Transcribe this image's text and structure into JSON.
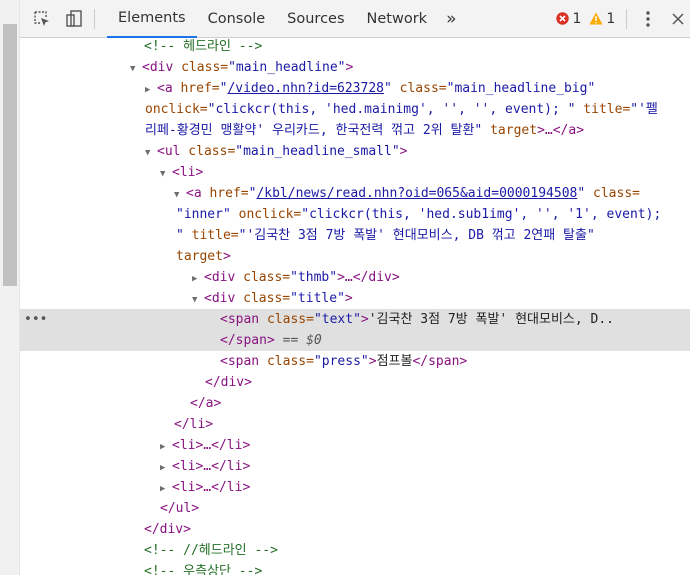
{
  "toolbar": {
    "tabs": [
      "Elements",
      "Console",
      "Sources",
      "Network"
    ],
    "more": "»",
    "error_count": "1",
    "warning_count": "1"
  },
  "tree": {
    "l01": "<!-- 헤드라인 -->",
    "l02_tag": "<div",
    "l02_attr": " class=",
    "l02_val": "\"main_headline\"",
    "l02_end": ">",
    "l03_tag": "<a",
    "l03_attr1": " href=",
    "l03_q1": "\"",
    "l03_link": "/video.nhn?id=623728",
    "l03_q2": "\"",
    "l03_attr2": " class=",
    "l03_val2": "\"main_headline_big\"",
    "l04_attr": "onclick=",
    "l04_val": "\"clickcr(this, 'hed.mainimg', '', '', event); \"",
    "l04_attr2": " title=",
    "l04_val2": "\"'펠",
    "l05_val": "리페-황경민 맹활약' 우리카드, 한국전력 꺾고 2위 탈환\"",
    "l05_attr": " target",
    "l05_end": ">…</a>",
    "l06_tag": "<ul",
    "l06_attr": " class=",
    "l06_val": "\"main_headline_small\"",
    "l06_end": ">",
    "l07": "<li>",
    "l08_tag": "<a",
    "l08_attr": " href=",
    "l08_q1": "\"",
    "l08_link": "/kbl/news/read.nhn?oid=065&aid=0000194508",
    "l08_q2": "\"",
    "l08_attr2": " class=",
    "l09_val": "\"inner\"",
    "l09_attr": " onclick=",
    "l09_val2": "\"clickcr(this, 'hed.sub1img', '', '1', event);",
    "l10_val": "\"",
    "l10_attr": " title=",
    "l10_val2": "\"'김국찬 3점 7방 폭발' 현대모비스, DB 꺾고 2연패 탈출\"",
    "l11_attr": "target",
    "l11_end": ">",
    "l12_tag": "<div",
    "l12_attr": " class=",
    "l12_val": "\"thmb\"",
    "l12_end": ">…</div>",
    "l13_tag": "<div",
    "l13_attr": " class=",
    "l13_val": "\"title\"",
    "l13_end": ">",
    "l14_tag": "<span",
    "l14_attr": " class=",
    "l14_val": "\"text\"",
    "l14_gt": ">",
    "l14_text": "'김국찬 3점 7방 폭발' 현대모비스, D..",
    "l15_tag": "</span>",
    "l15_eq": " == $0",
    "l16_tag": "<span",
    "l16_attr": " class=",
    "l16_val": "\"press\"",
    "l16_gt": ">",
    "l16_text": "점프볼",
    "l16_end": "</span>",
    "l17": "</div>",
    "l18": "</a>",
    "l19": "</li>",
    "l20": "<li>…</li>",
    "l21": "<li>…</li>",
    "l22": "<li>…</li>",
    "l23": "</ul>",
    "l24": "</div>",
    "l25": "<!-- //헤드라인 -->",
    "l26": "<!-- 우측상단 -->"
  },
  "colors": {
    "tag": "#881280",
    "attr": "#994500",
    "value": "#1a1aa6",
    "comment": "#236e25",
    "active_tab": "#1a73e8",
    "error": "#d93025",
    "warning": "#f9ab00"
  }
}
